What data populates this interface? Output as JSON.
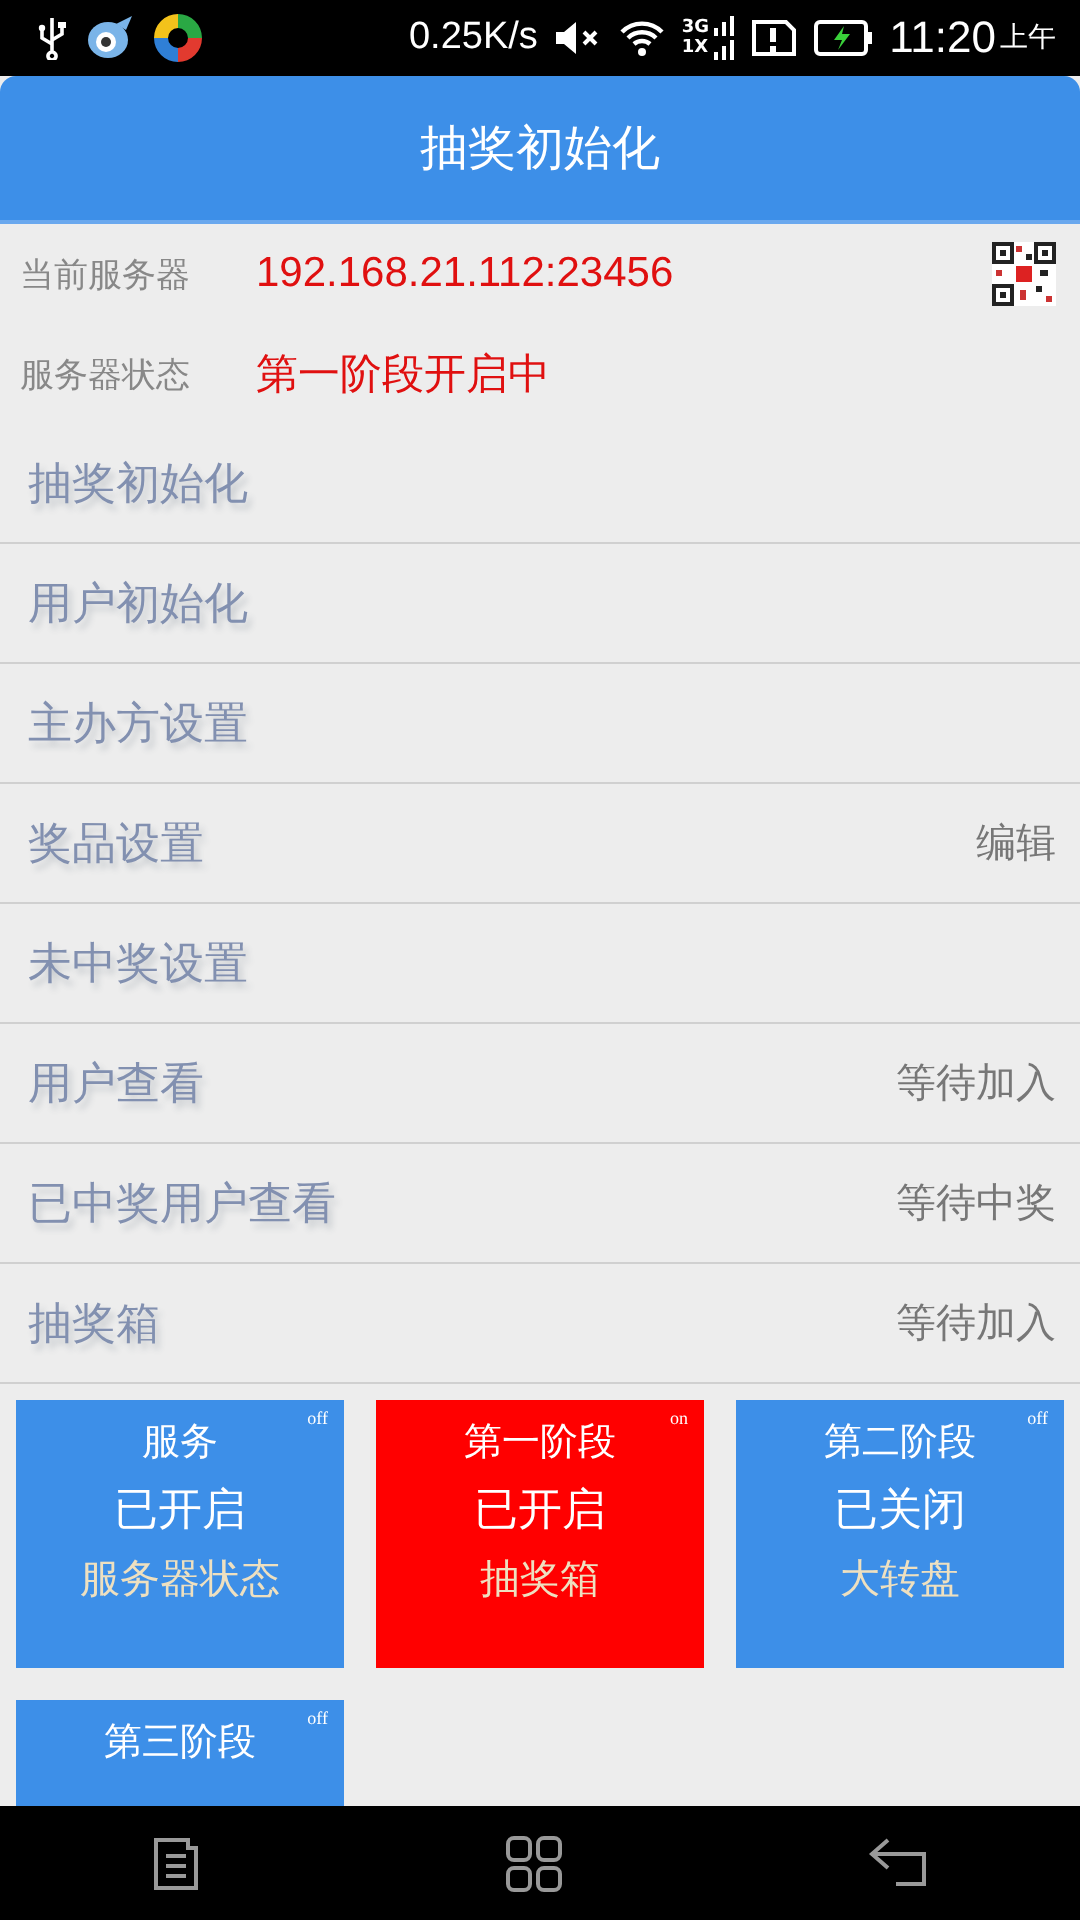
{
  "status_bar": {
    "speed": "0.25K/s",
    "network_top": "3G",
    "network_bottom": "1X",
    "time": "11:20",
    "period": "上午"
  },
  "header": {
    "title": "抽奖初始化"
  },
  "info": [
    {
      "label": "当前服务器",
      "value": "192.168.21.112:23456"
    },
    {
      "label": "服务器状态",
      "value": "第一阶段开启中"
    }
  ],
  "menu": [
    {
      "label": "抽奖初始化"
    },
    {
      "label": "用户初始化"
    },
    {
      "label": "主办方设置"
    },
    {
      "label": "奖品设置",
      "detail": "编辑"
    },
    {
      "label": "未中奖设置"
    },
    {
      "label": "用户查看",
      "detail": "等待加入"
    },
    {
      "label": "已中奖用户查看",
      "detail": "等待中奖"
    },
    {
      "label": "抽奖箱",
      "detail": "等待加入"
    }
  ],
  "tiles": [
    {
      "title": "服务",
      "status": "已开启",
      "subtitle": "服务器状态",
      "switch": "off",
      "on": false
    },
    {
      "title": "第一阶段",
      "status": "已开启",
      "subtitle": "抽奖箱",
      "switch": "on",
      "on": true
    },
    {
      "title": "第二阶段",
      "status": "已关闭",
      "subtitle": "大转盘",
      "switch": "off",
      "on": false
    },
    {
      "title": "第三阶段",
      "switch": "off",
      "on": false
    }
  ]
}
